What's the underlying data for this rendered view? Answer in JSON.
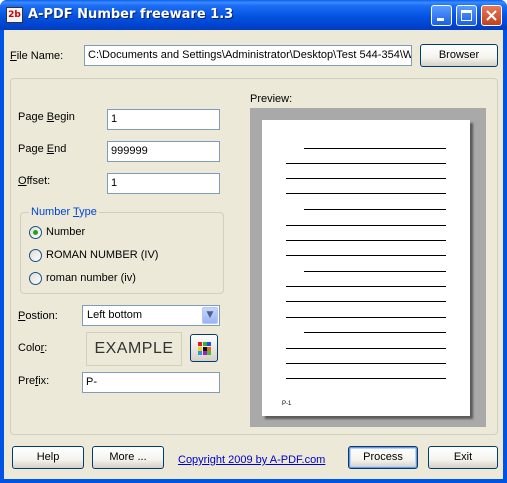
{
  "window": {
    "title": "A-PDF Number freeware 1.3",
    "icon_text": "2b",
    "controls": [
      "minimize",
      "maximize",
      "close"
    ]
  },
  "file": {
    "label_u": "F",
    "label_rest": "ile Name:",
    "value": "C:\\Documents and Settings\\Administrator\\Desktop\\Test 544-354\\Word",
    "browse_label": "Browser"
  },
  "fields": {
    "page_begin_pre": "Page ",
    "page_begin_u": "B",
    "page_begin_post": "egin",
    "page_begin_value": "1",
    "page_end_pre": "Page ",
    "page_end_u": "E",
    "page_end_post": "nd",
    "page_end_value": "999999",
    "offset_u": "O",
    "offset_post": "ffset:",
    "offset_value": "1"
  },
  "number_type": {
    "title_pre": "Number ",
    "title_u": "T",
    "title_post": "ype",
    "options": [
      {
        "label": "Number",
        "selected": true
      },
      {
        "label": "ROMAN NUMBER (IV)",
        "selected": false
      },
      {
        "label": "roman number (iv)",
        "selected": false
      }
    ]
  },
  "position": {
    "label_u": "P",
    "label_rest": "ostion:",
    "value": "Left bottom"
  },
  "color": {
    "label_pre": "Colo",
    "label_u": "r",
    "label_post": ":",
    "sample_text": "EXAMPLE",
    "palette_icon": "color-palette-icon",
    "swatches": [
      "#e0182d",
      "#2db82d",
      "#1f4fe0",
      "#f0d020",
      "#101010",
      "#e07020",
      "#20a0e0",
      "#a020c0",
      "#40c040"
    ]
  },
  "prefix": {
    "label_pre": "Pre",
    "label_u": "f",
    "label_post": "ix:",
    "value": "P-"
  },
  "preview": {
    "label": "Preview:",
    "page_number_text": "P-1"
  },
  "buttons": {
    "help": "Help",
    "more": "More ...",
    "process": "Process",
    "exit": "Exit"
  },
  "copyright_link": "Copyright 2009 by A-PDF.com",
  "colors": {
    "titlebar": "#0054e3",
    "dialog_bg": "#ece9d8",
    "group_title": "#0046d5",
    "link": "#0000cc"
  }
}
